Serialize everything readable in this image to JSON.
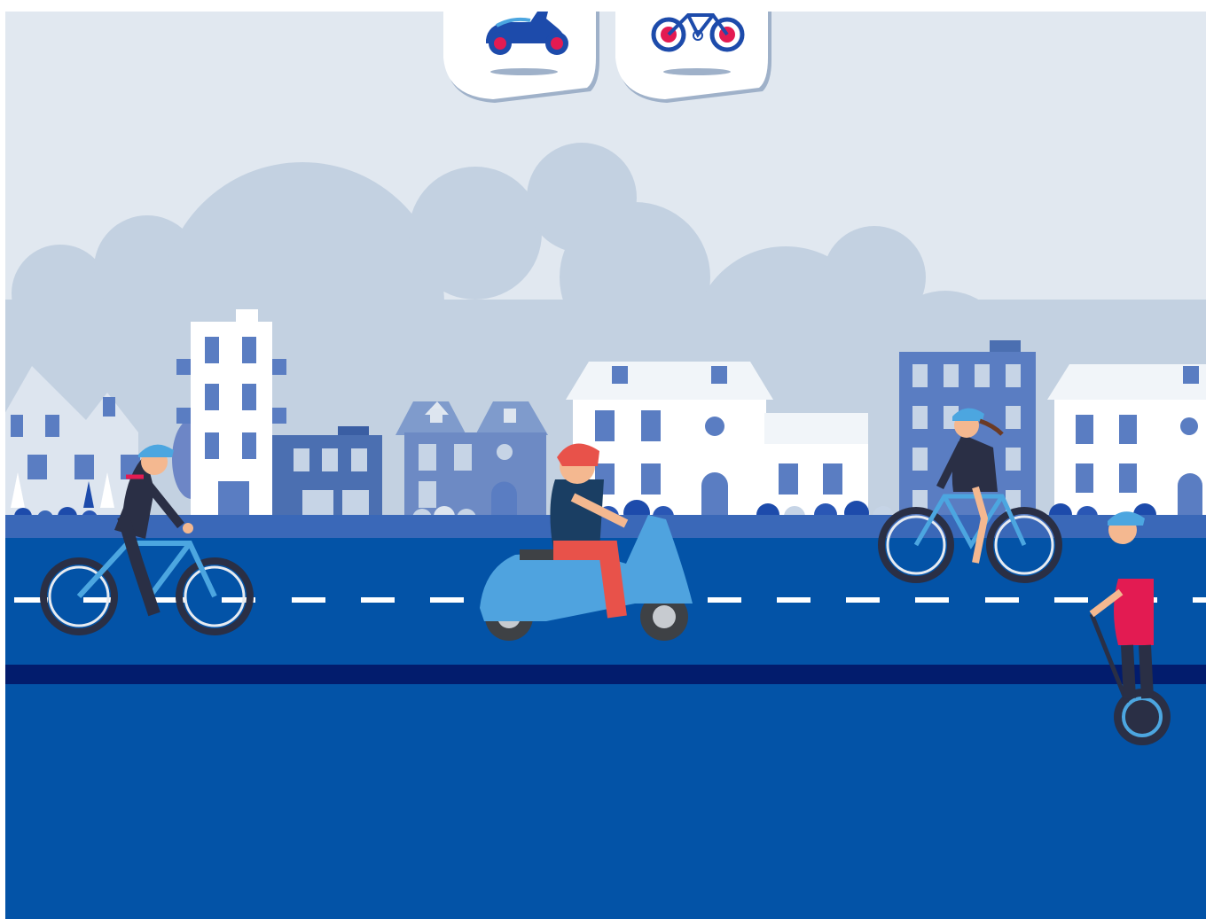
{
  "scene": {
    "colors": {
      "sky": "#e1e8f0",
      "clouds": "#c3d1e1",
      "road": "#0353a7",
      "road_edge": "#3a68b8",
      "curb_dark": "#021c6d",
      "lane_marking": "#ffffff",
      "helmet_blue": "#4ca6e0",
      "helmet_red": "#e8524a",
      "scooter_blue": "#4fa3df"
    },
    "tabs": [
      {
        "name": "scooter",
        "icon": "scooter-icon",
        "selected": true
      },
      {
        "name": "bicycle",
        "icon": "bicycle-icon",
        "selected": false
      }
    ],
    "characters": [
      {
        "name": "cyclist-man",
        "vehicle": "bicycle",
        "helmet": "blue"
      },
      {
        "name": "scooter-rider",
        "vehicle": "scooter",
        "helmet": "red"
      },
      {
        "name": "cyclist-woman",
        "vehicle": "bicycle",
        "helmet": "blue"
      },
      {
        "name": "segway-rider",
        "vehicle": "segway",
        "helmet": "blue"
      }
    ]
  }
}
